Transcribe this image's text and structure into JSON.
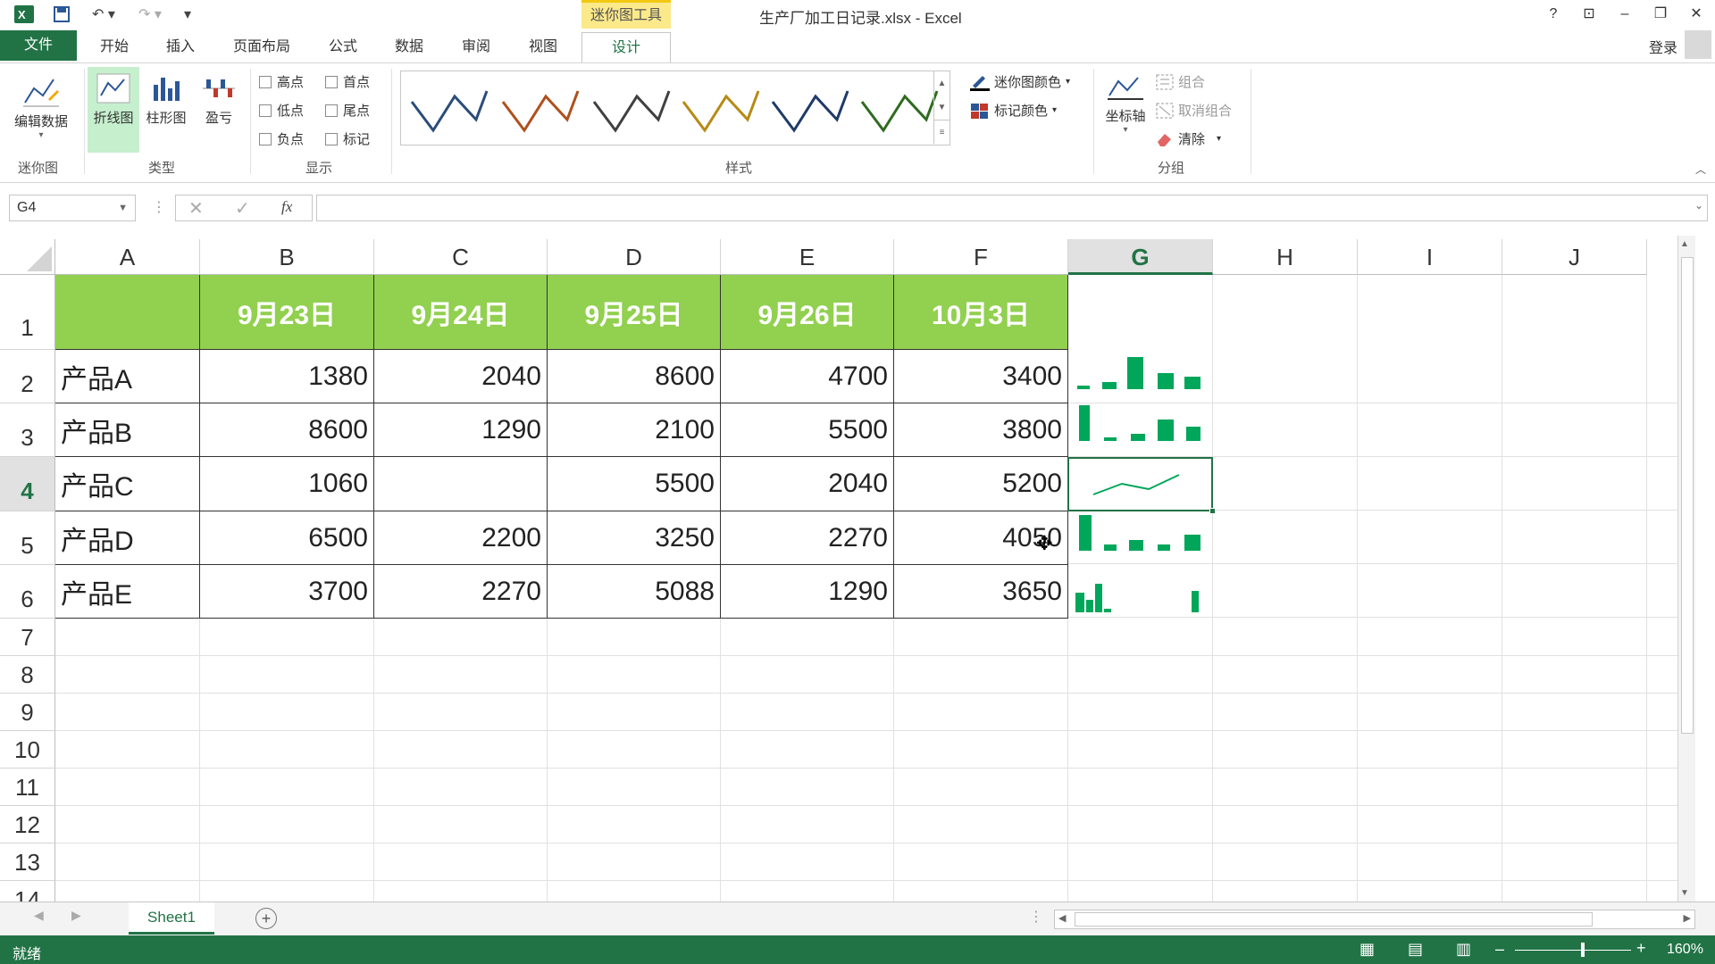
{
  "title_bar": {
    "context_tab": "迷你图工具",
    "window_title": "生产厂加工日记录.xlsx - Excel",
    "help": "?",
    "minimize": "–",
    "restore": "❐",
    "close": "✕"
  },
  "tabs": [
    "文件",
    "开始",
    "插入",
    "页面布局",
    "公式",
    "数据",
    "审阅",
    "视图",
    "设计"
  ],
  "login": "登录",
  "ribbon": {
    "sparkline_group": {
      "label": "迷你图",
      "edit_data": "编辑数据"
    },
    "type_group": {
      "label": "类型",
      "line": "折线图",
      "column": "柱形图",
      "win_loss": "盈亏"
    },
    "show_group": {
      "label": "显示",
      "high_point": "高点",
      "low_point": "低点",
      "negative_point": "负点",
      "first_point": "首点",
      "last_point": "尾点",
      "markers": "标记"
    },
    "style_group": {
      "label": "样式"
    },
    "color": {
      "sparkline_color": "迷你图颜色",
      "marker_color": "标记颜色"
    },
    "group_group": {
      "label": "分组",
      "axis": "坐标轴",
      "group": "组合",
      "ungroup": "取消组合",
      "clear": "清除"
    }
  },
  "formula_bar": {
    "name_box": "G4",
    "fx": "fx",
    "value": ""
  },
  "columns": [
    "A",
    "B",
    "C",
    "D",
    "E",
    "F",
    "G",
    "H",
    "I",
    "J"
  ],
  "rows": [
    "1",
    "2",
    "3",
    "4",
    "5",
    "6",
    "7",
    "8",
    "9",
    "10",
    "11",
    "12",
    "13",
    "14"
  ],
  "table": {
    "headers": [
      "",
      "9月23日",
      "9月24日",
      "9月25日",
      "9月26日",
      "10月3日"
    ],
    "data": [
      [
        "产品A",
        "1380",
        "2040",
        "8600",
        "4700",
        "3400"
      ],
      [
        "产品B",
        "8600",
        "1290",
        "2100",
        "5500",
        "3800"
      ],
      [
        "产品C",
        "1060",
        "",
        "5500",
        "2040",
        "5200"
      ],
      [
        "产品D",
        "6500",
        "2200",
        "3250",
        "2270",
        "4050"
      ],
      [
        "产品E",
        "3700",
        "2270",
        "5088",
        "1290",
        "3650"
      ]
    ]
  },
  "sheet_tab": "Sheet1",
  "status": {
    "ready": "就绪",
    "zoom": "160%"
  },
  "colors": {
    "excel_green": "#217346",
    "header_fill": "#92d050",
    "sparkline": "#00a65a"
  }
}
